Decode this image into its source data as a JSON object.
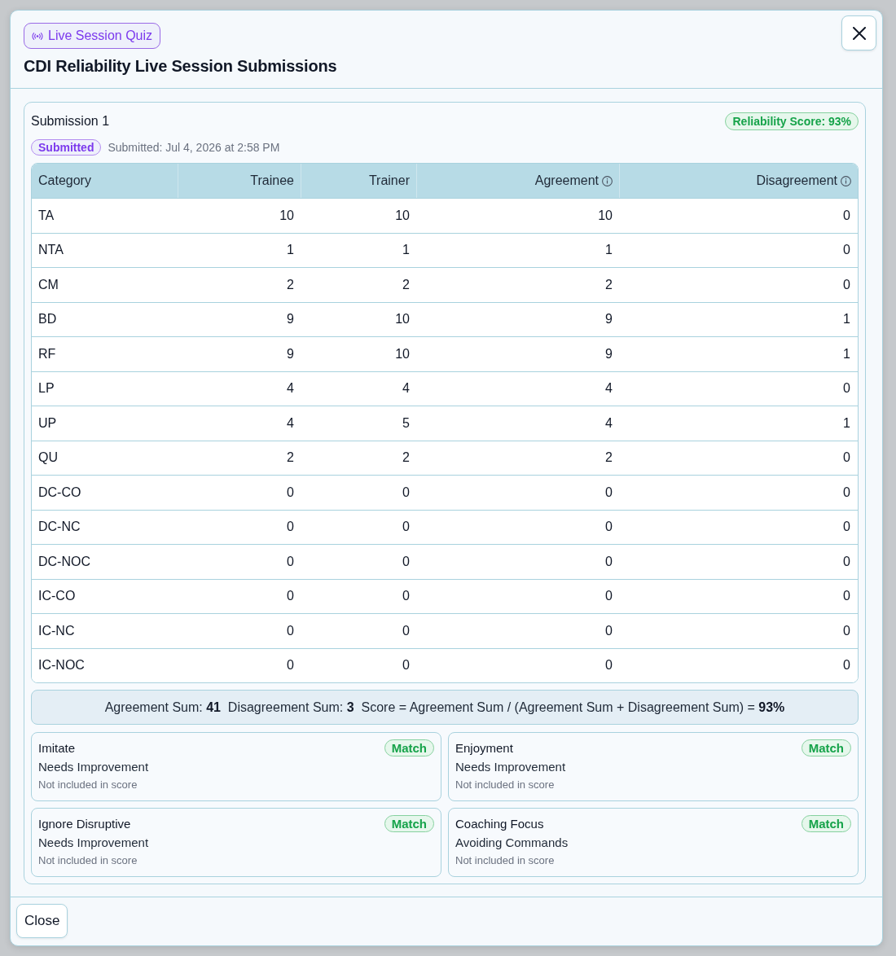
{
  "dialog": {
    "badge": "Live Session Quiz",
    "title": "CDI Reliability Live Session Submissions"
  },
  "submission": {
    "title": "Submission 1",
    "score_badge": "Reliability Score: 93%",
    "status": "Submitted",
    "submitted_at": "Submitted: Jul 4, 2026 at 2:58 PM",
    "table": {
      "columns": [
        {
          "label": "Category",
          "info": false
        },
        {
          "label": "Trainee",
          "info": false
        },
        {
          "label": "Trainer",
          "info": false
        },
        {
          "label": "Agreement",
          "info": true
        },
        {
          "label": "Disagreement",
          "info": true
        }
      ],
      "rows": [
        [
          "TA",
          "10",
          "10",
          "10",
          "0"
        ],
        [
          "NTA",
          "1",
          "1",
          "1",
          "0"
        ],
        [
          "CM",
          "2",
          "2",
          "2",
          "0"
        ],
        [
          "BD",
          "9",
          "10",
          "9",
          "1"
        ],
        [
          "RF",
          "9",
          "10",
          "9",
          "1"
        ],
        [
          "LP",
          "4",
          "4",
          "4",
          "0"
        ],
        [
          "UP",
          "4",
          "5",
          "4",
          "1"
        ],
        [
          "QU",
          "2",
          "2",
          "2",
          "0"
        ],
        [
          "DC-CO",
          "0",
          "0",
          "0",
          "0"
        ],
        [
          "DC-NC",
          "0",
          "0",
          "0",
          "0"
        ],
        [
          "DC-NOC",
          "0",
          "0",
          "0",
          "0"
        ],
        [
          "IC-CO",
          "0",
          "0",
          "0",
          "0"
        ],
        [
          "IC-NC",
          "0",
          "0",
          "0",
          "0"
        ],
        [
          "IC-NOC",
          "0",
          "0",
          "0",
          "0"
        ]
      ]
    },
    "summary": "Agreement Sum: **41**  Disagreement Sum: **3**  Score = Agreement Sum / (Agreement Sum + Disagreement Sum) = **93%**",
    "criteria": [
      {
        "label": "Imitate",
        "result": "Match",
        "value": "Needs Improvement",
        "note": "Not included in score"
      },
      {
        "label": "Enjoyment",
        "result": "Match",
        "value": "Needs Improvement",
        "note": "Not included in score"
      },
      {
        "label": "Ignore Disruptive",
        "result": "Match",
        "value": "Needs Improvement",
        "note": "Not included in score"
      },
      {
        "label": "Coaching Focus",
        "result": "Match",
        "value": "Avoiding Commands",
        "note": "Not included in score"
      }
    ]
  },
  "footer": {
    "close_button": "Close"
  }
}
